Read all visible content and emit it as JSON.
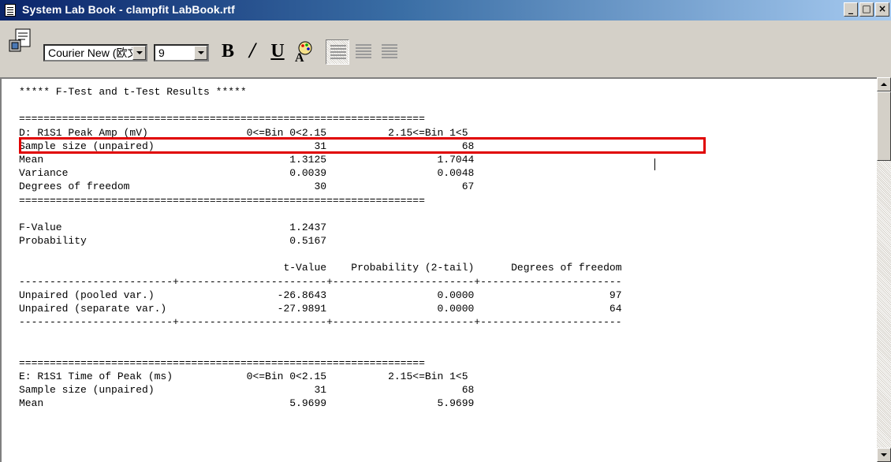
{
  "window": {
    "title": "System Lab Book - clampfit LabBook.rtf",
    "min": "_",
    "max": "□",
    "close": "×"
  },
  "toolbar": {
    "font_name": "Courier New (欧文)",
    "font_size": "9",
    "bold_label": "B",
    "italic_label": "/",
    "underline_label": "U",
    "color_label": "A"
  },
  "document": {
    "lines": [
      "***** F-Test and t-Test Results *****",
      "",
      "==================================================================",
      "D: R1S1 Peak Amp (mV)                0<=Bin 0<2.15          2.15<=Bin 1<5",
      "Sample size (unpaired)                          31                      68",
      "Mean                                        1.3125                  1.7044",
      "Variance                                    0.0039                  0.0048",
      "Degrees of freedom                              30                      67",
      "==================================================================",
      "",
      "F-Value                                     1.2437",
      "Probability                                 0.5167",
      "",
      "                                           t-Value    Probability (2-tail)      Degrees of freedom",
      "-------------------------+------------------------+-----------------------+-----------------------",
      "Unpaired (pooled var.)                    -26.8643                  0.0000                      97",
      "Unpaired (separate var.)                  -27.9891                  0.0000                      64",
      "-------------------------+------------------------+-----------------------+-----------------------",
      "",
      "",
      "==================================================================",
      "E: R1S1 Time of Peak (ms)            0<=Bin 0<2.15          2.15<=Bin 1<5",
      "Sample size (unpaired)                          31                      68",
      "Mean                                        5.9699                  5.9699"
    ]
  }
}
